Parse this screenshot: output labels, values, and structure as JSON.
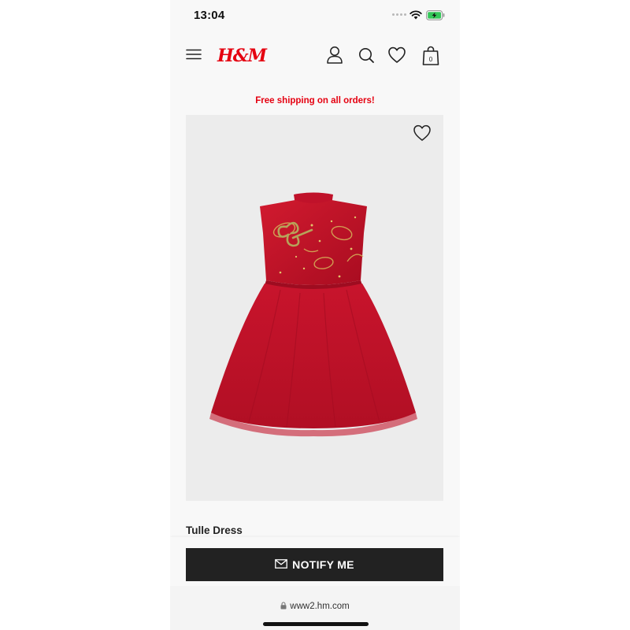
{
  "status_bar": {
    "time": "13:04"
  },
  "header": {
    "brand": "H&M",
    "icons": [
      "menu-icon",
      "account-icon",
      "search-icon",
      "favorites-icon",
      "shopping-bag-icon"
    ],
    "bag_count": "0",
    "brand_color": "#e50010"
  },
  "promo": {
    "text": "Free shipping on all orders!"
  },
  "product": {
    "title": "Tulle Dress",
    "image_alt": "Red tulle dress with satin bodice",
    "fav_icon": "heart-outline-icon"
  },
  "notify": {
    "label": "NOTIFY ME",
    "icon": "envelope-icon"
  },
  "browser": {
    "url": "www2.hm.com"
  },
  "colors": {
    "accent_red": "#e50010",
    "button_dark": "#222222",
    "dress_red": "#c8102e"
  }
}
